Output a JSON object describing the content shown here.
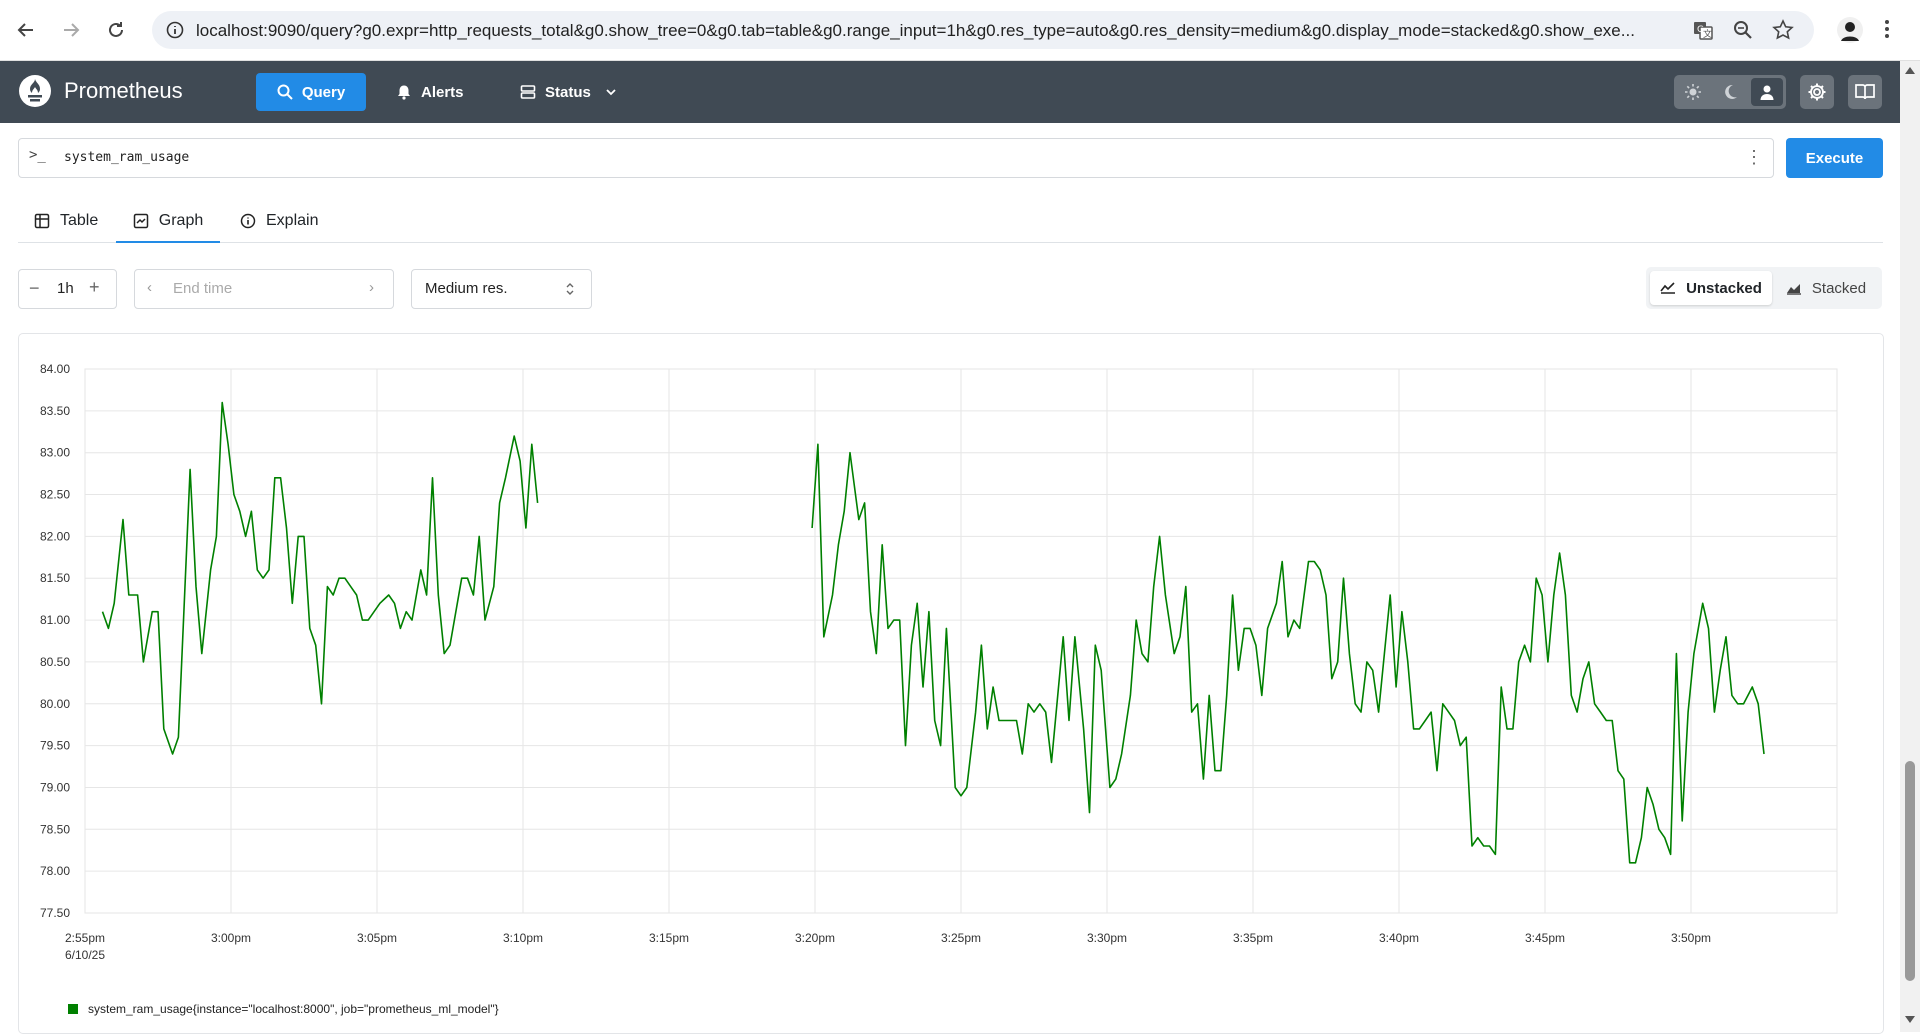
{
  "browser": {
    "url": "localhost:9090/query?g0.expr=http_requests_total&g0.show_tree=0&g0.tab=table&g0.range_input=1h&g0.res_type=auto&g0.res_density=medium&g0.display_mode=stacked&g0.show_exe..."
  },
  "header": {
    "brand": "Prometheus",
    "nav": {
      "query": "Query",
      "alerts": "Alerts",
      "status": "Status"
    },
    "accent_color": "#228be6",
    "bg_color": "#404a54"
  },
  "query": {
    "expression": "system_ram_usage",
    "execute_label": "Execute"
  },
  "tabs": {
    "table": "Table",
    "graph": "Graph",
    "explain": "Explain",
    "active": "Graph"
  },
  "controls": {
    "range": "1h",
    "end_time_placeholder": "End time",
    "resolution": "Medium res.",
    "unstacked": "Unstacked",
    "stacked": "Stacked",
    "active_mode": "Unstacked"
  },
  "chart_data": {
    "type": "line",
    "title": "",
    "xlabel": "",
    "ylabel": "",
    "ylim": [
      77.5,
      84.0
    ],
    "xlim": [
      0,
      60
    ],
    "y_ticks": [
      "84.00",
      "83.50",
      "83.00",
      "82.50",
      "82.00",
      "81.50",
      "81.00",
      "80.50",
      "80.00",
      "79.50",
      "79.00",
      "78.50",
      "78.00",
      "77.50"
    ],
    "x_ticks": [
      {
        "t": 0,
        "label": "2:55pm",
        "sublabel": "6/10/25"
      },
      {
        "t": 5,
        "label": "3:00pm"
      },
      {
        "t": 10,
        "label": "3:05pm"
      },
      {
        "t": 15,
        "label": "3:10pm"
      },
      {
        "t": 20,
        "label": "3:15pm"
      },
      {
        "t": 25,
        "label": "3:20pm"
      },
      {
        "t": 30,
        "label": "3:25pm"
      },
      {
        "t": 35,
        "label": "3:30pm"
      },
      {
        "t": 40,
        "label": "3:35pm"
      },
      {
        "t": 45,
        "label": "3:40pm"
      },
      {
        "t": 50,
        "label": "3:45pm"
      },
      {
        "t": 55,
        "label": "3:50pm"
      }
    ],
    "grid": true,
    "legend_position": "bottom-left",
    "series": [
      {
        "name": "system_ram_usage{instance=\"localhost:8000\", job=\"prometheus_ml_model\"}",
        "color": "#008000",
        "segments": [
          [
            [
              0.6,
              81.1
            ],
            [
              0.8,
              80.9
            ],
            [
              1.0,
              81.2
            ],
            [
              1.3,
              82.2
            ],
            [
              1.5,
              81.3
            ],
            [
              1.8,
              81.3
            ],
            [
              2.0,
              80.5
            ],
            [
              2.3,
              81.1
            ],
            [
              2.5,
              81.1
            ],
            [
              2.7,
              79.7
            ],
            [
              3.0,
              79.4
            ],
            [
              3.2,
              79.6
            ],
            [
              3.6,
              82.8
            ],
            [
              3.8,
              81.4
            ],
            [
              4.0,
              80.6
            ],
            [
              4.3,
              81.6
            ],
            [
              4.5,
              82.0
            ],
            [
              4.7,
              83.6
            ],
            [
              4.9,
              83.1
            ],
            [
              5.1,
              82.5
            ],
            [
              5.3,
              82.3
            ],
            [
              5.5,
              82.0
            ],
            [
              5.7,
              82.3
            ],
            [
              5.9,
              81.6
            ],
            [
              6.1,
              81.5
            ],
            [
              6.3,
              81.6
            ],
            [
              6.5,
              82.7
            ],
            [
              6.7,
              82.7
            ],
            [
              6.9,
              82.1
            ],
            [
              7.1,
              81.2
            ],
            [
              7.3,
              82.0
            ],
            [
              7.5,
              82.0
            ],
            [
              7.7,
              80.9
            ],
            [
              7.9,
              80.7
            ],
            [
              8.1,
              80.0
            ],
            [
              8.3,
              81.4
            ],
            [
              8.5,
              81.3
            ],
            [
              8.7,
              81.5
            ],
            [
              8.9,
              81.5
            ],
            [
              9.1,
              81.4
            ],
            [
              9.3,
              81.3
            ],
            [
              9.5,
              81.0
            ],
            [
              9.7,
              81.0
            ],
            [
              10.1,
              81.2
            ],
            [
              10.4,
              81.3
            ],
            [
              10.6,
              81.2
            ],
            [
              10.8,
              80.9
            ],
            [
              11.0,
              81.1
            ],
            [
              11.2,
              81.0
            ],
            [
              11.5,
              81.6
            ],
            [
              11.7,
              81.3
            ],
            [
              11.9,
              82.7
            ],
            [
              12.1,
              81.3
            ],
            [
              12.3,
              80.6
            ],
            [
              12.5,
              80.7
            ],
            [
              12.9,
              81.5
            ],
            [
              13.1,
              81.5
            ],
            [
              13.3,
              81.3
            ],
            [
              13.5,
              82.0
            ],
            [
              13.7,
              81.0
            ],
            [
              14.0,
              81.4
            ],
            [
              14.2,
              82.4
            ],
            [
              14.4,
              82.7
            ],
            [
              14.7,
              83.2
            ],
            [
              14.9,
              82.9
            ],
            [
              15.1,
              82.1
            ],
            [
              15.3,
              83.1
            ],
            [
              15.5,
              82.4
            ]
          ],
          [
            [
              24.9,
              82.1
            ],
            [
              25.1,
              83.1
            ],
            [
              25.3,
              80.8
            ],
            [
              25.6,
              81.3
            ],
            [
              25.8,
              81.9
            ],
            [
              26.0,
              82.3
            ],
            [
              26.2,
              83.0
            ],
            [
              26.5,
              82.2
            ],
            [
              26.7,
              82.4
            ],
            [
              26.9,
              81.1
            ],
            [
              27.1,
              80.6
            ],
            [
              27.3,
              81.9
            ],
            [
              27.5,
              80.9
            ],
            [
              27.7,
              81.0
            ],
            [
              27.9,
              81.0
            ],
            [
              28.1,
              79.5
            ],
            [
              28.3,
              80.7
            ],
            [
              28.5,
              81.2
            ],
            [
              28.7,
              80.2
            ],
            [
              28.9,
              81.1
            ],
            [
              29.1,
              79.8
            ],
            [
              29.3,
              79.5
            ],
            [
              29.5,
              80.9
            ],
            [
              29.8,
              79.0
            ],
            [
              30.0,
              78.9
            ],
            [
              30.2,
              79.0
            ],
            [
              30.5,
              79.9
            ],
            [
              30.7,
              80.7
            ],
            [
              30.9,
              79.7
            ],
            [
              31.1,
              80.2
            ],
            [
              31.3,
              79.8
            ],
            [
              31.5,
              79.8
            ],
            [
              31.9,
              79.8
            ],
            [
              32.1,
              79.4
            ],
            [
              32.3,
              80.0
            ],
            [
              32.5,
              79.9
            ],
            [
              32.7,
              80.0
            ],
            [
              32.9,
              79.9
            ],
            [
              33.1,
              79.3
            ],
            [
              33.5,
              80.8
            ],
            [
              33.7,
              79.8
            ],
            [
              33.9,
              80.8
            ],
            [
              34.2,
              79.7
            ],
            [
              34.4,
              78.7
            ],
            [
              34.6,
              80.7
            ],
            [
              34.8,
              80.4
            ],
            [
              35.1,
              79.0
            ],
            [
              35.3,
              79.1
            ],
            [
              35.5,
              79.4
            ],
            [
              35.8,
              80.1
            ],
            [
              36.0,
              81.0
            ],
            [
              36.2,
              80.6
            ],
            [
              36.4,
              80.5
            ],
            [
              36.6,
              81.4
            ],
            [
              36.8,
              82.0
            ],
            [
              37.0,
              81.3
            ],
            [
              37.3,
              80.6
            ],
            [
              37.5,
              80.8
            ],
            [
              37.7,
              81.4
            ],
            [
              37.9,
              79.9
            ],
            [
              38.1,
              80.0
            ],
            [
              38.3,
              79.1
            ],
            [
              38.5,
              80.1
            ],
            [
              38.7,
              79.2
            ],
            [
              38.9,
              79.2
            ],
            [
              39.1,
              80.1
            ],
            [
              39.3,
              81.3
            ],
            [
              39.5,
              80.4
            ],
            [
              39.7,
              80.9
            ],
            [
              39.9,
              80.9
            ],
            [
              40.1,
              80.7
            ],
            [
              40.3,
              80.1
            ],
            [
              40.5,
              80.9
            ],
            [
              40.8,
              81.2
            ],
            [
              41.0,
              81.7
            ],
            [
              41.2,
              80.8
            ],
            [
              41.4,
              81.0
            ],
            [
              41.6,
              80.9
            ],
            [
              41.9,
              81.7
            ],
            [
              42.1,
              81.7
            ],
            [
              42.3,
              81.6
            ],
            [
              42.5,
              81.3
            ],
            [
              42.7,
              80.3
            ],
            [
              42.9,
              80.5
            ],
            [
              43.1,
              81.5
            ],
            [
              43.3,
              80.6
            ],
            [
              43.5,
              80.0
            ],
            [
              43.7,
              79.9
            ],
            [
              43.9,
              80.5
            ],
            [
              44.1,
              80.4
            ],
            [
              44.3,
              79.9
            ],
            [
              44.5,
              80.6
            ],
            [
              44.7,
              81.3
            ],
            [
              44.9,
              80.2
            ],
            [
              45.1,
              81.1
            ],
            [
              45.3,
              80.5
            ],
            [
              45.5,
              79.7
            ],
            [
              45.7,
              79.7
            ],
            [
              45.9,
              79.8
            ],
            [
              46.1,
              79.9
            ],
            [
              46.3,
              79.2
            ],
            [
              46.5,
              80.0
            ],
            [
              46.7,
              79.9
            ],
            [
              46.9,
              79.8
            ],
            [
              47.1,
              79.5
            ],
            [
              47.3,
              79.6
            ],
            [
              47.5,
              78.3
            ],
            [
              47.7,
              78.4
            ],
            [
              47.9,
              78.3
            ],
            [
              48.1,
              78.3
            ],
            [
              48.3,
              78.2
            ],
            [
              48.5,
              80.2
            ],
            [
              48.7,
              79.7
            ],
            [
              48.9,
              79.7
            ],
            [
              49.1,
              80.5
            ],
            [
              49.3,
              80.7
            ],
            [
              49.5,
              80.5
            ],
            [
              49.7,
              81.5
            ],
            [
              49.9,
              81.3
            ],
            [
              50.1,
              80.5
            ],
            [
              50.3,
              81.3
            ],
            [
              50.5,
              81.8
            ],
            [
              50.7,
              81.3
            ],
            [
              50.9,
              80.1
            ],
            [
              51.1,
              79.9
            ],
            [
              51.3,
              80.3
            ],
            [
              51.5,
              80.5
            ],
            [
              51.7,
              80.0
            ],
            [
              51.9,
              79.9
            ],
            [
              52.1,
              79.8
            ],
            [
              52.3,
              79.8
            ],
            [
              52.5,
              79.2
            ],
            [
              52.7,
              79.1
            ],
            [
              52.9,
              78.1
            ],
            [
              53.1,
              78.1
            ],
            [
              53.3,
              78.4
            ],
            [
              53.5,
              79.0
            ],
            [
              53.7,
              78.8
            ],
            [
              53.9,
              78.5
            ],
            [
              54.1,
              78.4
            ],
            [
              54.3,
              78.2
            ],
            [
              54.5,
              80.6
            ],
            [
              54.7,
              78.6
            ],
            [
              54.9,
              79.9
            ],
            [
              55.1,
              80.6
            ],
            [
              55.4,
              81.2
            ],
            [
              55.6,
              80.9
            ],
            [
              55.8,
              79.9
            ],
            [
              56.0,
              80.4
            ],
            [
              56.2,
              80.8
            ],
            [
              56.4,
              80.1
            ],
            [
              56.6,
              80.0
            ],
            [
              56.8,
              80.0
            ],
            [
              57.1,
              80.2
            ],
            [
              57.3,
              80.0
            ],
            [
              57.5,
              79.4
            ]
          ]
        ]
      }
    ]
  }
}
